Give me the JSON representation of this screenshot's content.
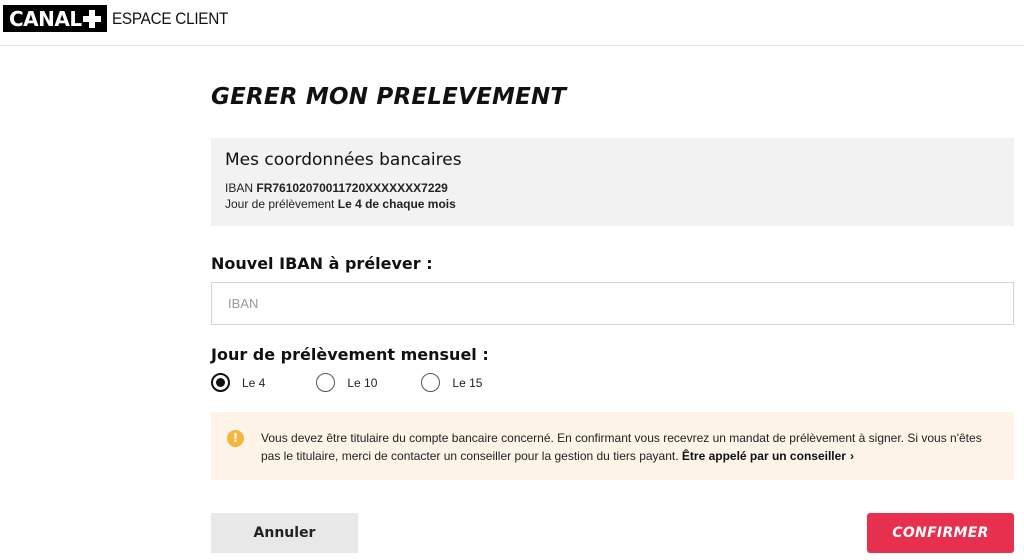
{
  "header": {
    "logo_text": "CANAL",
    "subtitle": "ESPACE CLIENT"
  },
  "page": {
    "title": "GERER MON PRELEVEMENT"
  },
  "bank_details": {
    "heading": "Mes coordonnées bancaires",
    "iban_label": "IBAN",
    "iban_value": "FR76102070011720XXXXXXX7229",
    "day_label": "Jour de prélèvement",
    "day_value": "Le 4 de chaque mois"
  },
  "new_iban": {
    "label": "Nouvel IBAN à prélever :",
    "placeholder": "IBAN",
    "value": ""
  },
  "monthly_day": {
    "label": "Jour de prélèvement mensuel :",
    "options": [
      "Le 4",
      "Le 10",
      "Le 15"
    ],
    "selected": "Le 4"
  },
  "notice": {
    "icon": "warning-icon",
    "color": "#f5b63d",
    "text": "Vous devez être titulaire du compte bancaire concerné. En confirmant vous recevrez un mandat de prélèvement à signer. Si vous n'êtes pas le titulaire, merci de contacter un conseiller pour la gestion du tiers payant.",
    "link_label": "Être appelé par un conseiller"
  },
  "actions": {
    "cancel_label": "Annuler",
    "confirm_label": "CONFIRMER",
    "confirm_color": "#e6304d"
  }
}
